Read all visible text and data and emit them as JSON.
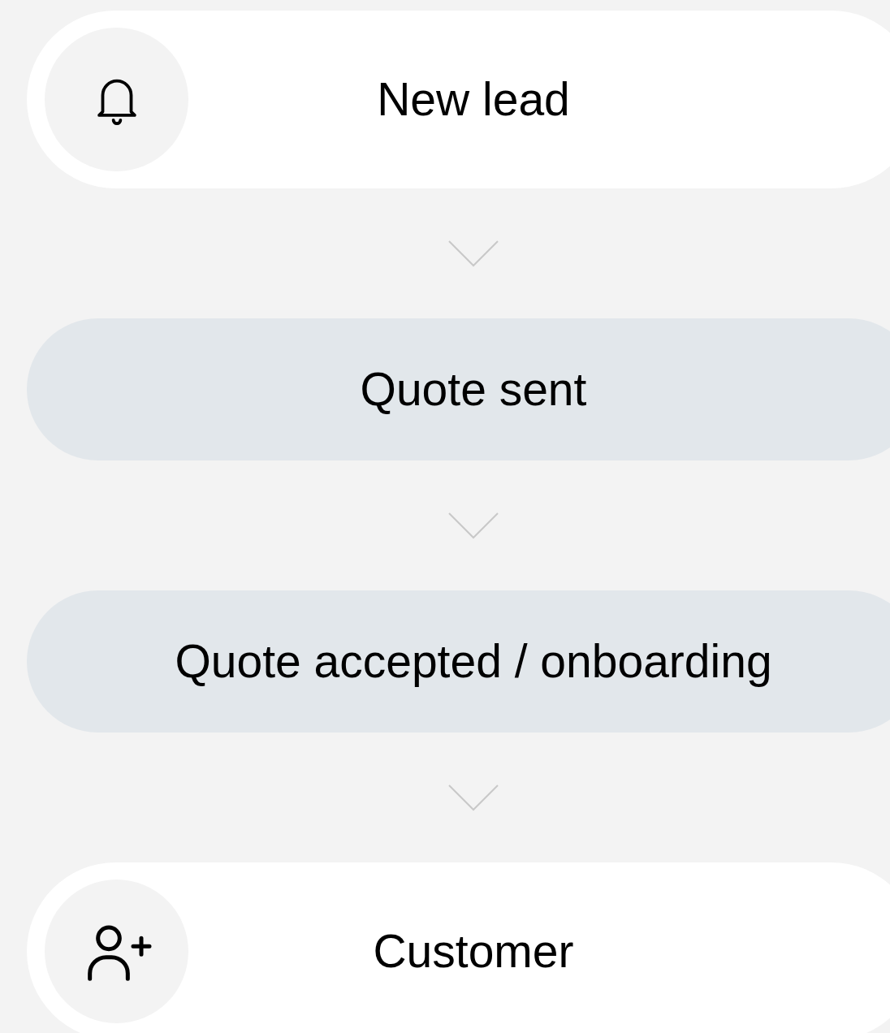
{
  "steps": [
    {
      "kind": "notification",
      "label": "New lead"
    },
    {
      "kind": "stage",
      "label": "Quote sent"
    },
    {
      "kind": "stage",
      "label": "Quote accepted / onboarding"
    },
    {
      "kind": "customer",
      "label": "Customer"
    }
  ]
}
